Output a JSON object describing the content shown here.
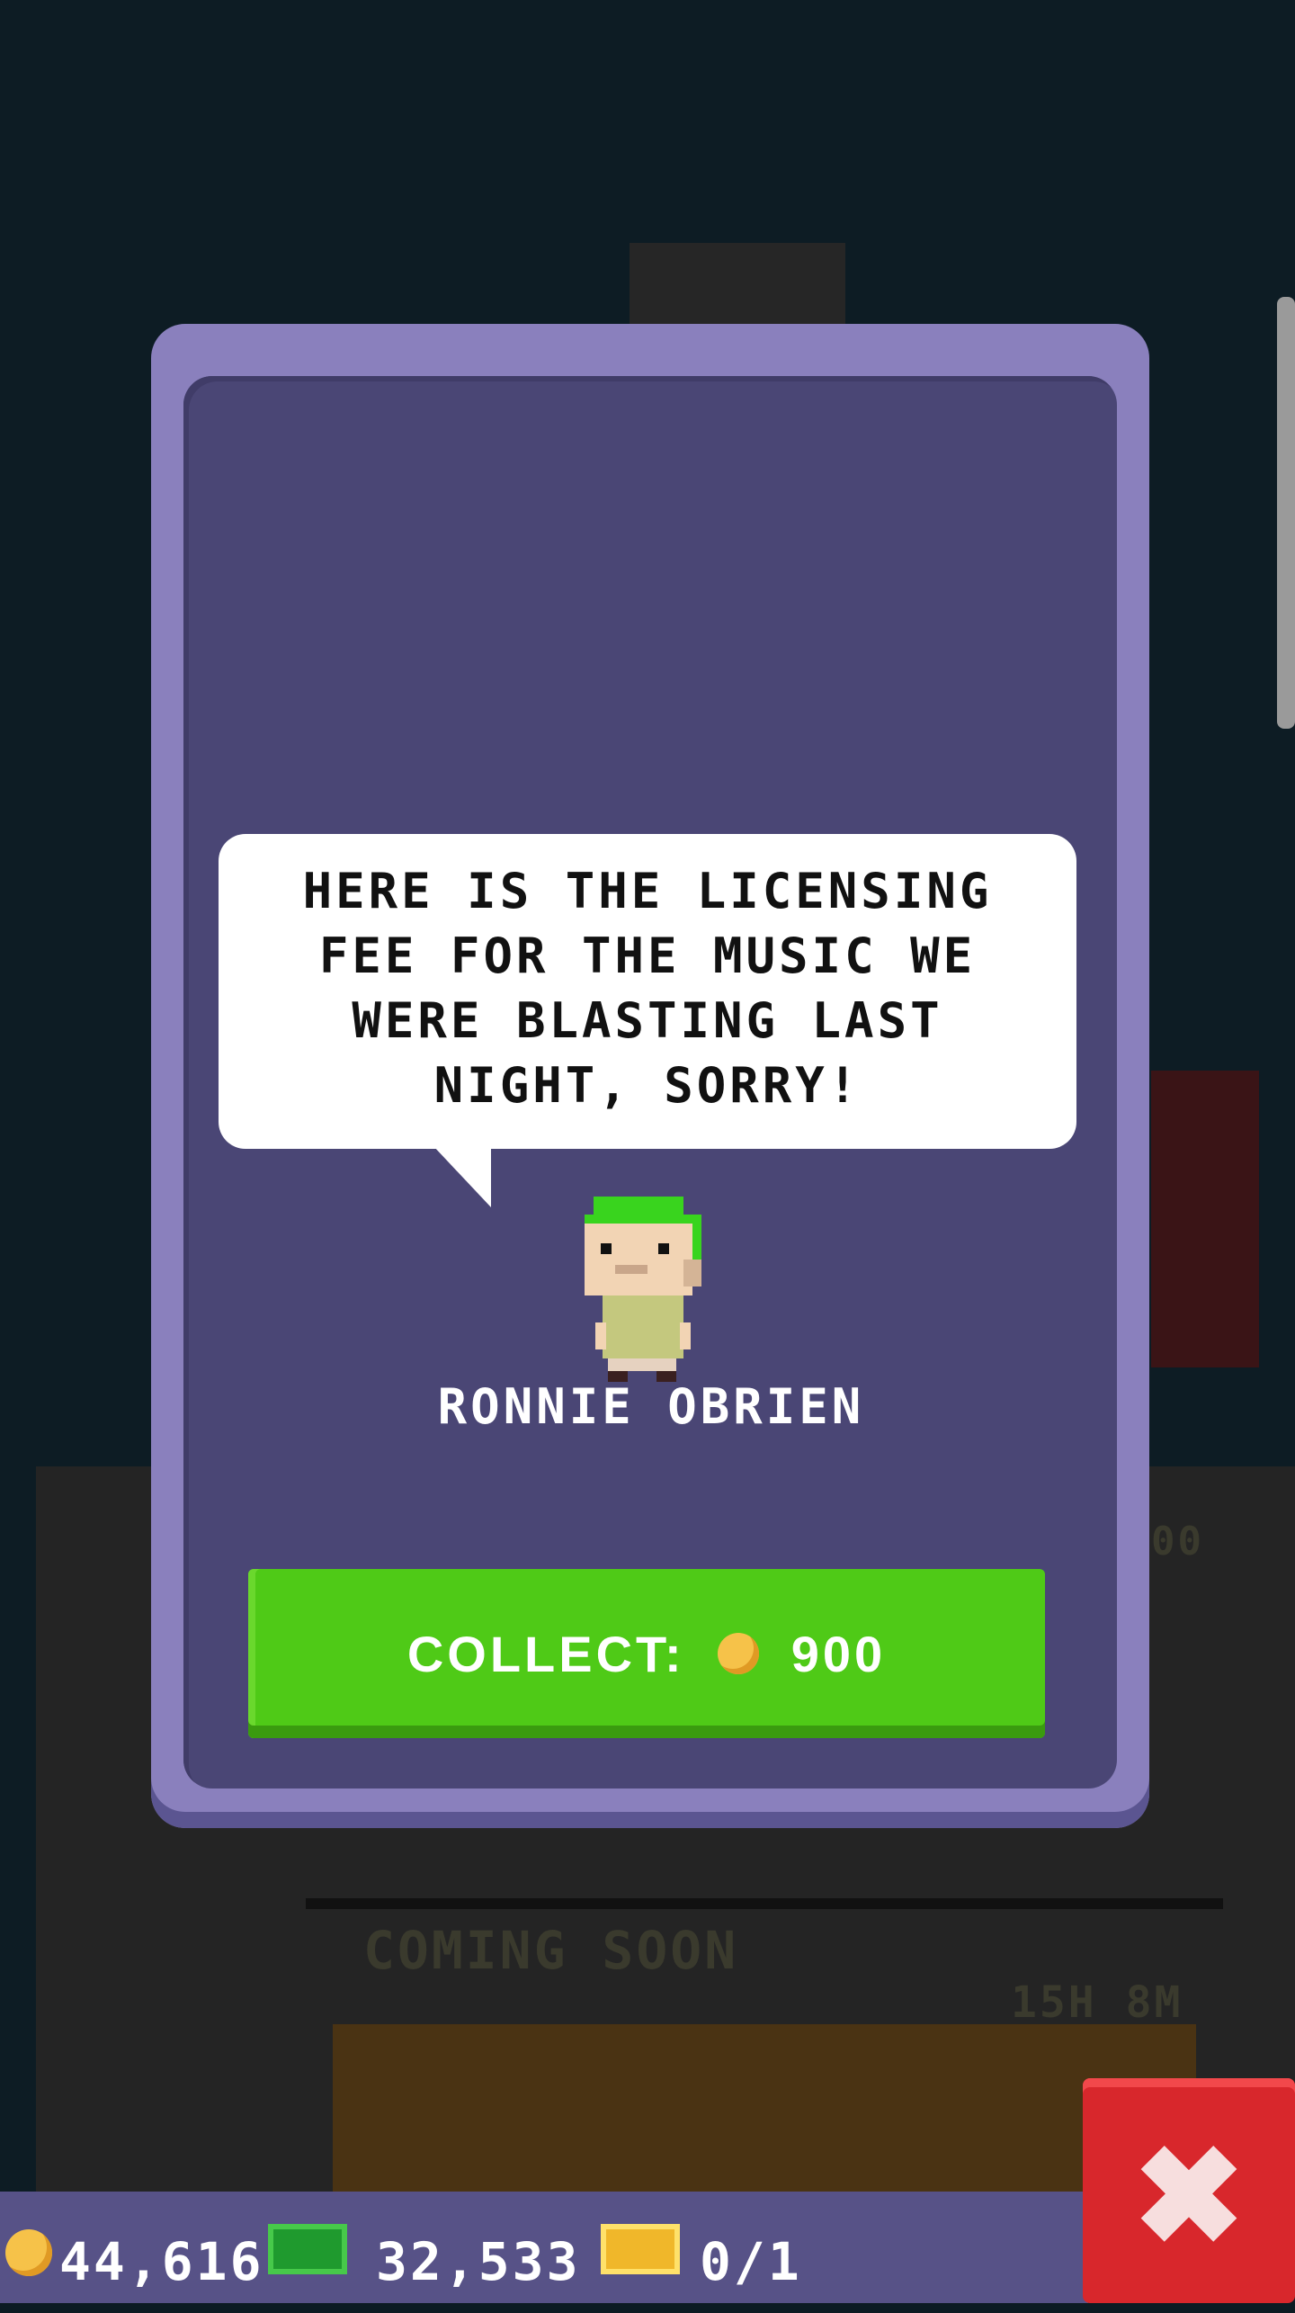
{
  "dialog": {
    "message": "HERE IS THE LICENSING FEE FOR THE MUSIC WE WERE BLASTING LAST NIGHT, SORRY!",
    "character_name": "RONNIE OBRIEN",
    "collect_label": "COLLECT:",
    "collect_amount": "900"
  },
  "background": {
    "floor_label": "COMING SOON",
    "timer": "15H 8M",
    "amount_fragment": "00"
  },
  "status_bar": {
    "coins": "44,616",
    "bux": "32,533",
    "tickets": "0/1"
  },
  "colors": {
    "modal_outer": "#8a80bd",
    "modal_inner": "#4a4675",
    "collect_button": "#4fca17",
    "close_button": "#d8272c",
    "bar": "#575287"
  },
  "icons": {
    "coin": "coin-icon",
    "cash": "bux-icon",
    "ticket": "vip-ticket-icon",
    "close": "close-icon"
  }
}
